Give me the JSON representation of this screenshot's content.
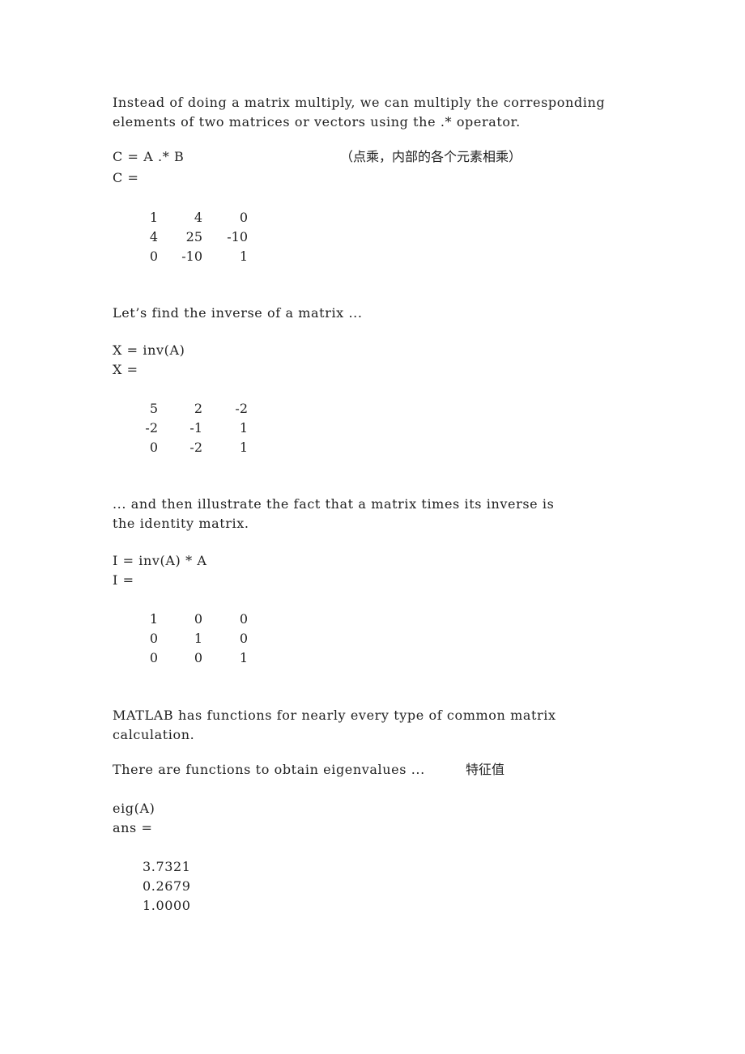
{
  "section_elementwise": {
    "para_line1": "Instead of doing a matrix multiply, we can multiply the corresponding",
    "para_line2": "elements of two matrices or vectors using the .* operator.",
    "command": "C = A .* B",
    "note": "（点乘，内部的各个元素相乘）",
    "result_label": "C =",
    "matrix": [
      [
        "1",
        "4",
        "0"
      ],
      [
        "4",
        "25",
        "-10"
      ],
      [
        "0",
        "-10",
        "1"
      ]
    ]
  },
  "section_inverse": {
    "para": "Let’s find the inverse of a matrix ...",
    "command": "X = inv(A)",
    "result_label": "X =",
    "matrix": [
      [
        "5",
        "2",
        "-2"
      ],
      [
        "-2",
        "-1",
        "1"
      ],
      [
        "0",
        "-2",
        "1"
      ]
    ]
  },
  "section_identity": {
    "para_line1": "... and then illustrate the fact that a matrix times its inverse is",
    "para_line2": "the identity matrix.",
    "command": "I = inv(A) * A",
    "result_label": "I =",
    "matrix": [
      [
        "1",
        "0",
        "0"
      ],
      [
        "0",
        "1",
        "0"
      ],
      [
        "0",
        "0",
        "1"
      ]
    ]
  },
  "section_eigen": {
    "para_line1": "MATLAB has functions for nearly every type of common matrix",
    "para_line2": "calculation.",
    "para2": "There are functions to obtain eigenvalues ...",
    "para2_note": "特征值",
    "command": "eig(A)",
    "result_label": "ans =",
    "values": [
      "3.7321",
      "0.2679",
      "1.0000"
    ]
  }
}
